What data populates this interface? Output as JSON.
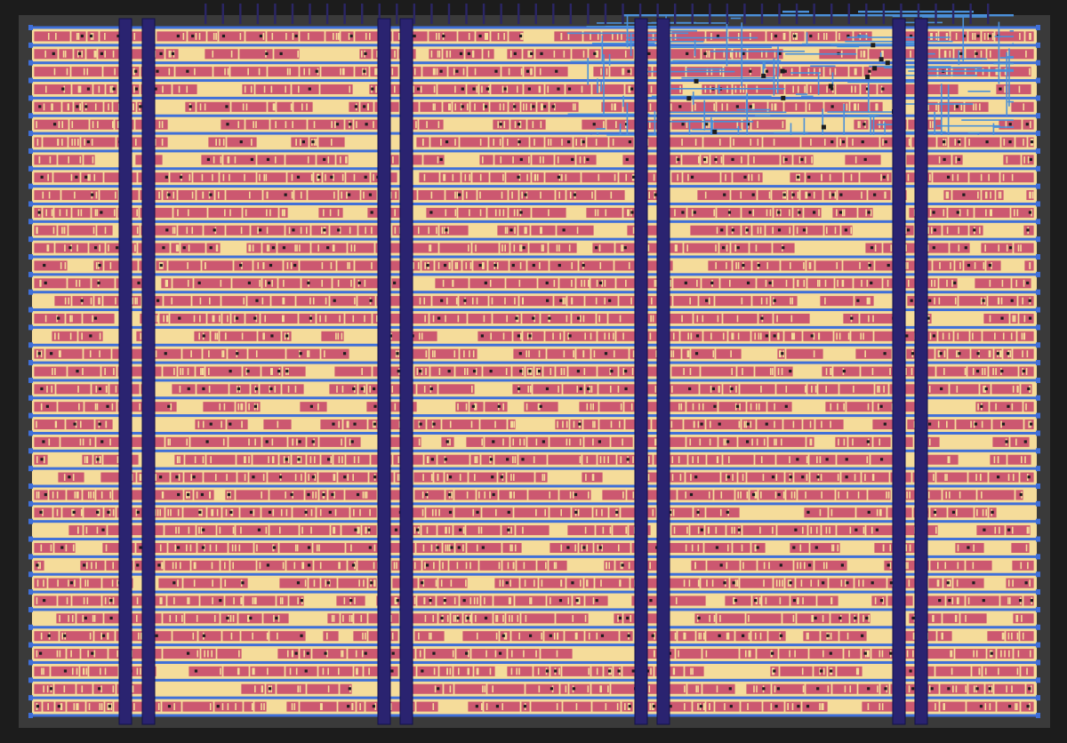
{
  "layout": {
    "rows": 39,
    "power_stripe_pairs": 4,
    "top_pins": 46,
    "colors": {
      "background": "#1c1c1c",
      "die": "#3a3a3a",
      "core": "#f5dc9a",
      "cell_fill": "#cc5870",
      "cell_outline": "#f5dc9a",
      "power_rail": "#3f6fd8",
      "power_stripe": "#2a2370",
      "stripe_edge": "#12104a",
      "route": "#4a90d9",
      "via": "#1d1d1d",
      "pin": "#2b2666"
    }
  }
}
